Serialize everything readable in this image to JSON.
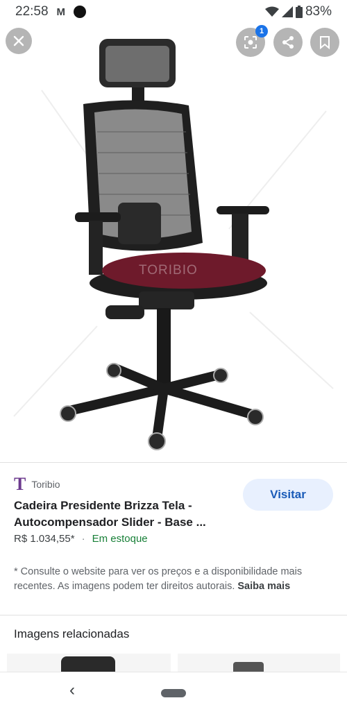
{
  "status_bar": {
    "time": "22:58",
    "mail_icon": "M",
    "battery": "83%"
  },
  "image_viewer": {
    "watermark": "TORIBIO",
    "lens_badge": "1"
  },
  "result": {
    "source_logo": "T",
    "source_name": "Toribio",
    "title": "Cadeira Presidente Brizza Tela - Autocompensador Slider - Base ...",
    "price": "R$ 1.034,55*",
    "separator": "·",
    "availability": "Em estoque",
    "visit_label": "Visitar"
  },
  "disclaimer": {
    "text": "* Consulte o website para ver os preços e a disponibilidade mais recentes. As imagens podem ter direitos autorais.",
    "link": "Saiba mais"
  },
  "related": {
    "title": "Imagens relacionadas"
  },
  "navigation": {
    "back_glyph": "‹"
  }
}
